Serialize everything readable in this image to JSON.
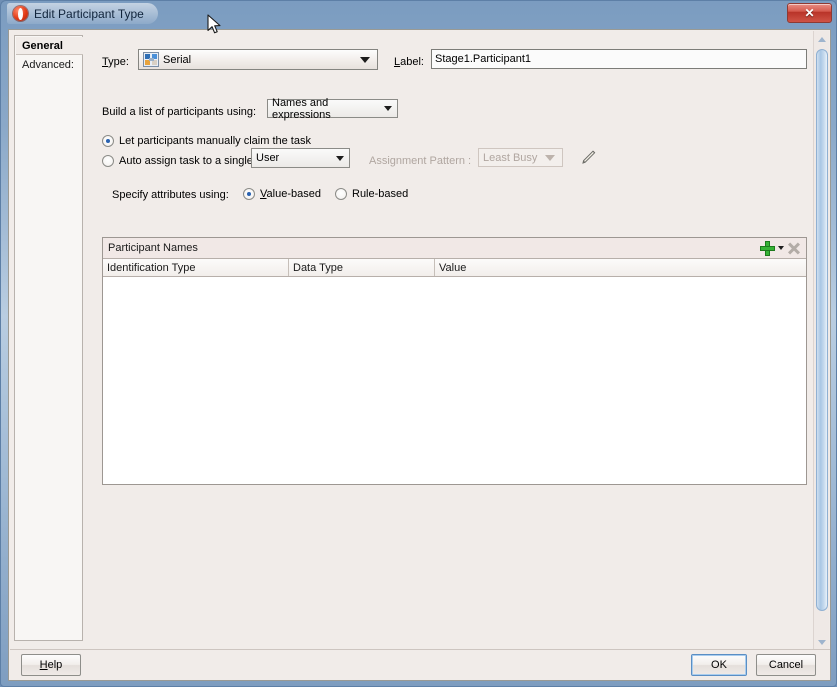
{
  "window": {
    "title": "Edit Participant Type",
    "app_icon": "oracle-app-icon",
    "close_label": "✕"
  },
  "nav": {
    "items": [
      {
        "label": "General",
        "selected": true
      },
      {
        "label": "Advanced:",
        "selected": false
      }
    ]
  },
  "form": {
    "type_label": "Type:",
    "type_mnemonic": "T",
    "type_value": "Serial",
    "label_label": "Label:",
    "label_mnemonic": "L",
    "label_value": "Stage1.Participant1",
    "build_list_label": "Build a list of participants using:",
    "build_list_value": "Names and expressions",
    "manual_claim_label": "Let participants manually claim the task",
    "manual_claim_selected": true,
    "auto_assign_label": "Auto assign task to a single",
    "auto_assign_selected": false,
    "auto_assign_value": "User",
    "assignment_pattern_label": "Assignment Pattern :",
    "assignment_pattern_value": "Least Busy",
    "assignment_pattern_disabled": true,
    "edit_pattern_icon": "pencil-icon",
    "specify_attributes_label": "Specify attributes using:",
    "value_based_label": "Value-based",
    "value_based_mnemonic": "V",
    "value_based_selected": true,
    "rule_based_label": "Rule-based",
    "rule_based_selected": false
  },
  "table": {
    "title": "Participant Names",
    "add_icon": "add-plus-icon",
    "delete_icon": "delete-x-icon",
    "columns": [
      "Identification Type",
      "Data Type",
      "Value"
    ],
    "rows": []
  },
  "footer": {
    "help_label": "Help",
    "help_mnemonic": "H",
    "ok_label": "OK",
    "cancel_label": "Cancel"
  },
  "scrollbar": {
    "orientation": "vertical",
    "up_arrow": "scroll-up-arrow",
    "down_arrow": "scroll-down-arrow"
  },
  "colors": {
    "titlebar": "#8aa8c8",
    "dialog_bg": "#f1ece9",
    "accent_blue": "#2a62b0",
    "close_red": "#c4402f",
    "add_green": "#36b336"
  }
}
